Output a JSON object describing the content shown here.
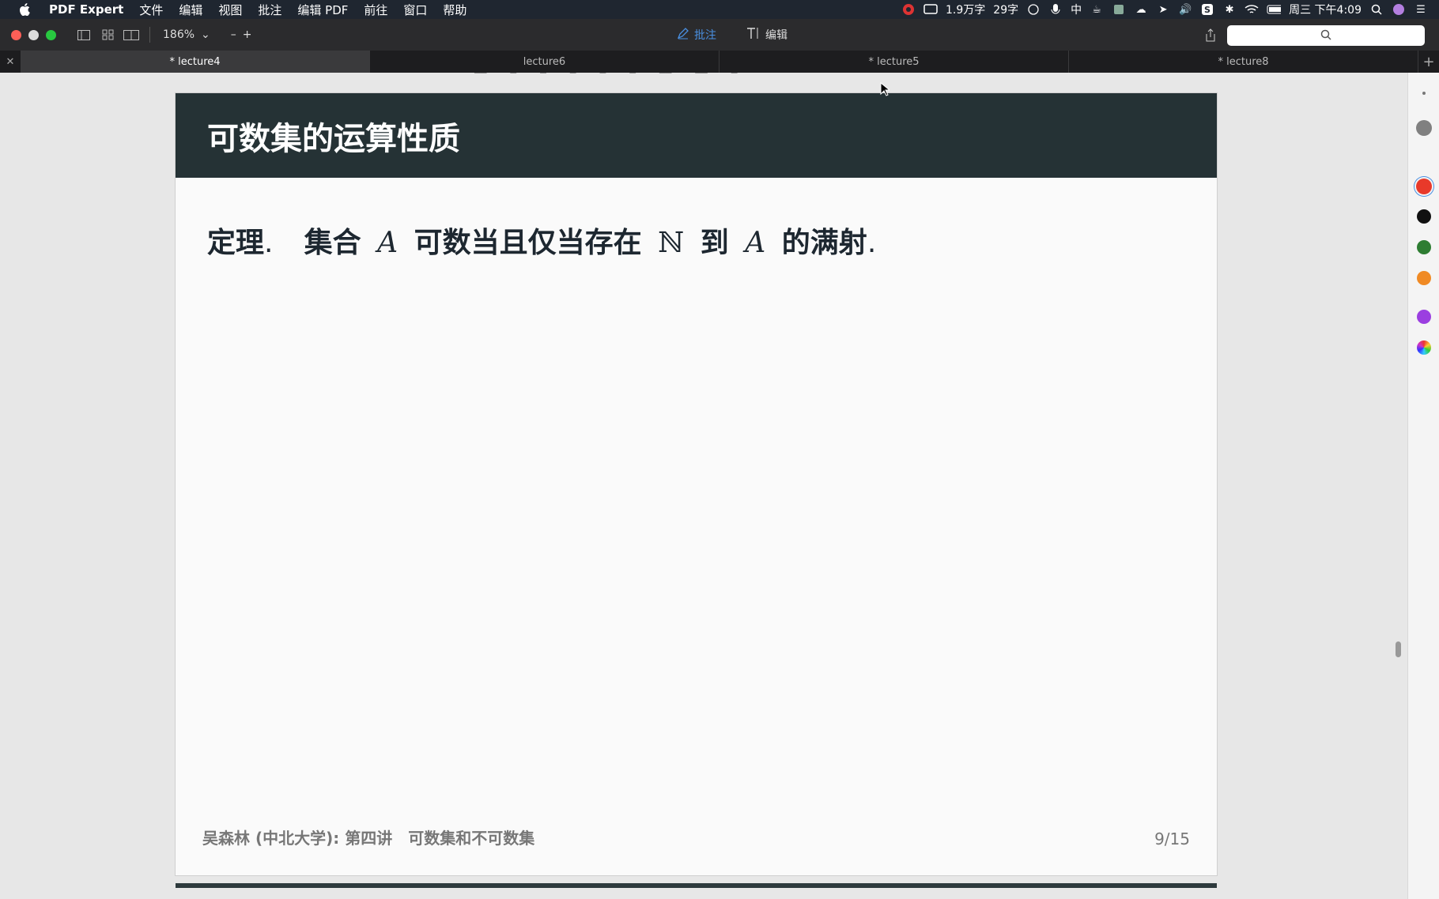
{
  "menubar": {
    "app_name": "PDF Expert",
    "items": [
      "文件",
      "编辑",
      "视图",
      "批注",
      "编辑 PDF",
      "前往",
      "窗口",
      "帮助"
    ],
    "status": {
      "word_count": "1.9万字",
      "char_count": "29字",
      "input_method": "中",
      "clock": "周三 下午4:09"
    }
  },
  "toolbar": {
    "zoom_level": "186%",
    "zoom_out": "–",
    "zoom_in": "+",
    "annotate_label": "批注",
    "edit_label": "编辑",
    "search_placeholder": ""
  },
  "tabs": [
    {
      "label": "* lecture4",
      "active": true
    },
    {
      "label": "lecture6",
      "active": false
    },
    {
      "label": "* lecture5",
      "active": false
    },
    {
      "label": "* lecture8",
      "active": false
    }
  ],
  "slide": {
    "title": "可数集的运算性质",
    "theorem_label": "定理",
    "theorem_dot": ".",
    "theorem_part1": "集合",
    "math_A": "A",
    "theorem_part2": "可数当且仅当存在",
    "math_N": "ℕ",
    "theorem_part3": "到",
    "theorem_part4": "的满射",
    "footer_left": "吴森林 (中北大学): 第四讲　可数集和不可数集",
    "page_number": "9/15"
  },
  "palette": {
    "colors": [
      "#808080",
      "#e8392a",
      "#111111",
      "#2e7d32",
      "#f08a24",
      "#9b3fe0"
    ],
    "selected": "#e8392a"
  }
}
